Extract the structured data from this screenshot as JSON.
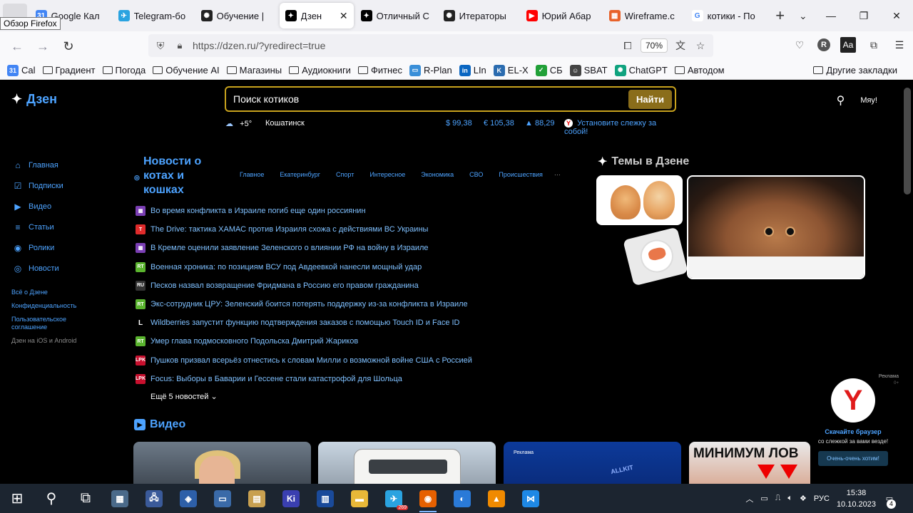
{
  "tooltip": "Обзор Firefox",
  "tabs": [
    {
      "title": "Google Кал",
      "icon": "google-calendar-icon",
      "color": "#4285f4",
      "glyph": "31"
    },
    {
      "title": "Telegram-бо",
      "icon": "telegram-icon",
      "color": "#2aa3e0",
      "glyph": "✈"
    },
    {
      "title": "Обучение |",
      "icon": "openai-icon",
      "color": "#222",
      "glyph": "✺"
    },
    {
      "title": "Дзен",
      "icon": "dzen-icon",
      "color": "#000",
      "glyph": "✦",
      "active": true
    },
    {
      "title": "Отличный С",
      "icon": "dzen-icon",
      "color": "#000",
      "glyph": "✦"
    },
    {
      "title": "Итераторы",
      "icon": "openai-icon",
      "color": "#222",
      "glyph": "✺"
    },
    {
      "title": "Юрий Абар",
      "icon": "youtube-icon",
      "color": "#ff0000",
      "glyph": "▶"
    },
    {
      "title": "Wireframe.c",
      "icon": "wireframe-icon",
      "color": "#e8622a",
      "glyph": "▦"
    },
    {
      "title": "котики - По",
      "icon": "google-icon",
      "color": "#fff",
      "glyph": "G"
    }
  ],
  "nav": {
    "url": "https://dzen.ru/?yredirect=true",
    "zoom": "70%",
    "profile_letter": "R",
    "reader_label": "Aa"
  },
  "bookmarks": [
    {
      "label": "Cal",
      "icon": "calendar-icon",
      "color": "#4285f4",
      "glyph": "31"
    },
    {
      "label": "Градиент",
      "folder": true
    },
    {
      "label": "Погода",
      "folder": true
    },
    {
      "label": "Обучение AI",
      "folder": true
    },
    {
      "label": "Магазины",
      "folder": true
    },
    {
      "label": "Аудиокниги",
      "folder": true
    },
    {
      "label": "Фитнес",
      "folder": true
    },
    {
      "label": "R-Plan",
      "icon": "rplan-icon",
      "color": "#3a8fd8",
      "glyph": "▭"
    },
    {
      "label": "LIn",
      "icon": "linkedin-icon",
      "color": "#0a66c2",
      "glyph": "in"
    },
    {
      "label": "EL-X",
      "icon": "elx-icon",
      "color": "#2b6cb0",
      "glyph": "K"
    },
    {
      "label": "СБ",
      "icon": "sber-icon",
      "color": "#21a038",
      "glyph": "✓"
    },
    {
      "label": "SBAT",
      "icon": "sbat-icon",
      "color": "#444",
      "glyph": "☺"
    },
    {
      "label": "ChatGPT",
      "icon": "chatgpt-icon",
      "color": "#10a37f",
      "glyph": "✺"
    },
    {
      "label": "Автодом",
      "folder": true
    }
  ],
  "bookmarks_other": "Другие закладки",
  "dzen": {
    "logo": "Дзен",
    "search_placeholder": "Поиск котиков",
    "search_button": "Найти",
    "greeting": "Мяу!",
    "weather_temp": "+5°",
    "city": "Кошатинск",
    "usd": "$ 99,38",
    "eur": "€ 105,38",
    "oil": "88,29",
    "tracking": "Установите слежку за собой!",
    "sidenav": [
      {
        "label": "Главная",
        "icon": "home-icon",
        "glyph": "⌂"
      },
      {
        "label": "Подписки",
        "icon": "subscriptions-icon",
        "glyph": "☑"
      },
      {
        "label": "Видео",
        "icon": "video-icon",
        "glyph": "▶"
      },
      {
        "label": "Статьи",
        "icon": "articles-icon",
        "glyph": "≡"
      },
      {
        "label": "Ролики",
        "icon": "shorts-icon",
        "glyph": "◉"
      },
      {
        "label": "Новости",
        "icon": "news-icon",
        "glyph": "◎"
      }
    ],
    "sidelinks": [
      "Всё о Дзене",
      "Конфиденциальность",
      "Пользовательское соглашение"
    ],
    "apps_line": "Дзен на iOS и Android",
    "news_title": "Новости о котах и кошках",
    "categories": [
      "Главное",
      "Екатеринбург",
      "Спорт",
      "Интересное",
      "Экономика",
      "СВО",
      "Происшествия"
    ],
    "news": [
      {
        "text": "Во время конфликта в Израиле погиб еще один россиянин",
        "src_color": "#7b3fb4",
        "src": "▦"
      },
      {
        "text": "The Drive: тактика ХАМАС против Израиля схожа с действиями ВС Украины",
        "src_color": "#e02b2b",
        "src": "T"
      },
      {
        "text": "В Кремле оценили заявление Зеленского о влиянии РФ на войну в Израиле",
        "src_color": "#7b3fb4",
        "src": "▦"
      },
      {
        "text": "Военная хроника: по позициям ВСУ под Авдеевкой нанесли мощный удар",
        "src_color": "#5ab42e",
        "src": "RT"
      },
      {
        "text": "Песков назвал возвращение Фридмана в Россию его правом гражданина",
        "src_color": "#333",
        "src": "RU"
      },
      {
        "text": "Экс-сотрудник ЦРУ: Зеленский боится потерять поддержку из-за конфликта в Израиле",
        "src_color": "#5ab42e",
        "src": "RT"
      },
      {
        "text": "Wildberries запустит функцию подтверждения заказов с помощью Touch ID и Face ID",
        "src_color": "#000",
        "src": "L"
      },
      {
        "text": "Умер глава подмосковного Подольска Дмитрий Жариков",
        "src_color": "#5ab42e",
        "src": "RT"
      },
      {
        "text": "Пушков призвал всерьёз отнестись к словам Милли о возможной войне США с Россией",
        "src_color": "#c8102e",
        "src": "LPK"
      },
      {
        "text": "Focus: Выборы в Баварии и Гессене стали катастрофой для Шольца",
        "src_color": "#c8102e",
        "src": "LPK"
      }
    ],
    "more_news": "Ещё 5 новостей",
    "video_title": "Видео",
    "video_ad_label": "Реклама",
    "video_brand": "ALLKIT",
    "video4_title": "МИНИМУМ ЛОВ",
    "themes_title": "Темы в Дзене",
    "promo": {
      "ad": "Реклама",
      "age": "0+",
      "title": "Скачайте браузер",
      "body": "со слежкой за вами везде!",
      "button": "Очень-очень хотим!"
    }
  },
  "taskbar": {
    "apps": [
      {
        "name": "start-button",
        "glyph": "⊞",
        "color": "transparent"
      },
      {
        "name": "search-icon",
        "glyph": "⚲",
        "color": "transparent"
      },
      {
        "name": "task-view-icon",
        "glyph": "⧉",
        "color": "transparent"
      },
      {
        "name": "calculator-icon",
        "glyph": "▦",
        "color": "#4a6a8a"
      },
      {
        "name": "network-app-icon",
        "glyph": "🖧",
        "color": "#3a5a9a"
      },
      {
        "name": "virtualbox-icon",
        "glyph": "◈",
        "color": "#2d5fa8"
      },
      {
        "name": "remote-desktop-icon",
        "glyph": "▭",
        "color": "#3a6aa8"
      },
      {
        "name": "archive-icon",
        "glyph": "▤",
        "color": "#c8a050"
      },
      {
        "name": "ki-icon",
        "glyph": "Ki",
        "color": "#3a3fb0"
      },
      {
        "name": "chart-app-icon",
        "glyph": "▥",
        "color": "#1a4a9a"
      },
      {
        "name": "explorer-icon",
        "glyph": "▬",
        "color": "#e8b838"
      },
      {
        "name": "telegram-icon",
        "glyph": "✈",
        "color": "#2aa3e0",
        "badge": "269"
      },
      {
        "name": "firefox-icon",
        "glyph": "◉",
        "color": "#e66000",
        "active": true
      },
      {
        "name": "chrome-icon",
        "glyph": "◐",
        "color": "#2a7ad8"
      },
      {
        "name": "vlc-icon",
        "glyph": "▲",
        "color": "#f08a00"
      },
      {
        "name": "vscode-icon",
        "glyph": "⋈",
        "color": "#1e88e5"
      }
    ],
    "lang": "РУС",
    "time": "15:38",
    "date": "10.10.2023",
    "notifications": "4"
  }
}
